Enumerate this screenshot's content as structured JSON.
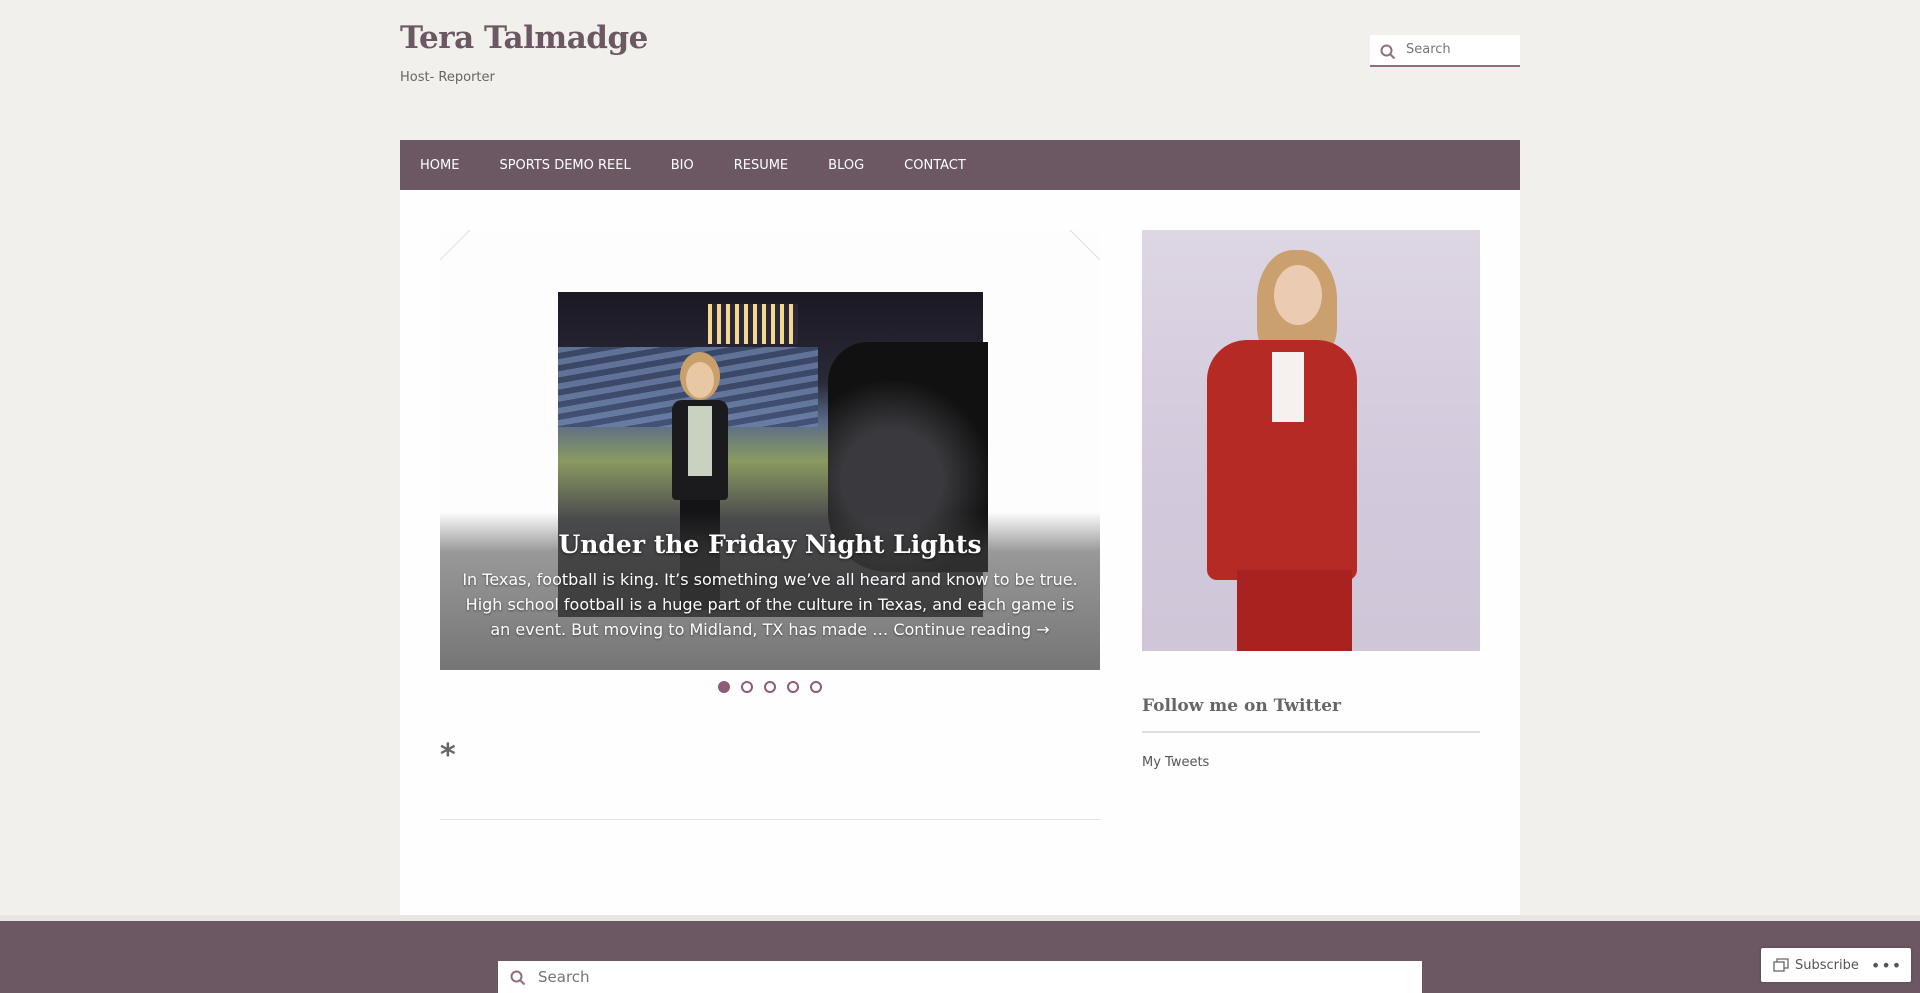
{
  "site": {
    "title": "Tera Talmadge",
    "tagline": "Host- Reporter"
  },
  "header_search": {
    "placeholder": "Search"
  },
  "nav": {
    "items": [
      {
        "label": "HOME"
      },
      {
        "label": "SPORTS DEMO REEL"
      },
      {
        "label": "BIO"
      },
      {
        "label": "RESUME"
      },
      {
        "label": "BLOG"
      },
      {
        "label": "CONTACT"
      }
    ]
  },
  "slider": {
    "title": "Under the Friday Night Lights",
    "excerpt": "In Texas, football is king. It’s something we’ve all heard and know to be true. High school football is a huge part of the culture in Texas, and each game is an event.  But moving to Midland, TX has made …",
    "more_link": "Continue reading →",
    "dot_count": 5,
    "active_dot": 1
  },
  "post": {
    "title": "*"
  },
  "sidebar": {
    "widget_title": "Follow me on Twitter",
    "tweets_link": "My Tweets"
  },
  "footer_search": {
    "placeholder": "Search"
  },
  "subscribe": {
    "label": "Subscribe",
    "more": "•••"
  },
  "colors": {
    "brand": "#6b5862",
    "accent": "#8e5c78",
    "background": "#f1f0ec"
  }
}
